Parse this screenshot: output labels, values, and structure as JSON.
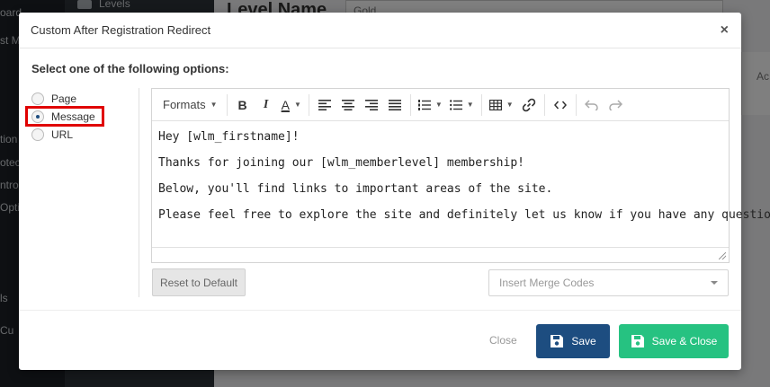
{
  "background": {
    "sidebar_labels": [
      "oard",
      "st M",
      "tion",
      "otec",
      "ntro",
      "Optio",
      "ls",
      "Cu"
    ],
    "subnav_item": "Levels",
    "level_title": "Level Name",
    "level_value": "Gold",
    "tab_partial": "Ac"
  },
  "modal": {
    "title": "Custom After Registration Redirect",
    "close_symbol": "×",
    "instruction": "Select one of the following options:",
    "options": [
      {
        "label": "Page",
        "checked": false
      },
      {
        "label": "Message",
        "checked": true
      },
      {
        "label": "URL",
        "checked": false
      }
    ],
    "toolbar": {
      "formats": "Formats",
      "bold": "B",
      "italic": "I",
      "text_color": "A"
    },
    "editor_lines": [
      "Hey [wlm_firstname]!",
      "Thanks for joining our [wlm_memberlevel] membership!",
      "Below, you'll find links to important areas of the site.",
      "Please feel free to explore the site and definitely let us know if you have any questions."
    ],
    "reset_label": "Reset to Default",
    "merge_codes_placeholder": "Insert Merge Codes",
    "close_label": "Close",
    "save_label": "Save",
    "save_close_label": "Save & Close",
    "colors": {
      "save": "#1d4d80",
      "save_close": "#26c281",
      "highlight": "#e00000"
    }
  }
}
